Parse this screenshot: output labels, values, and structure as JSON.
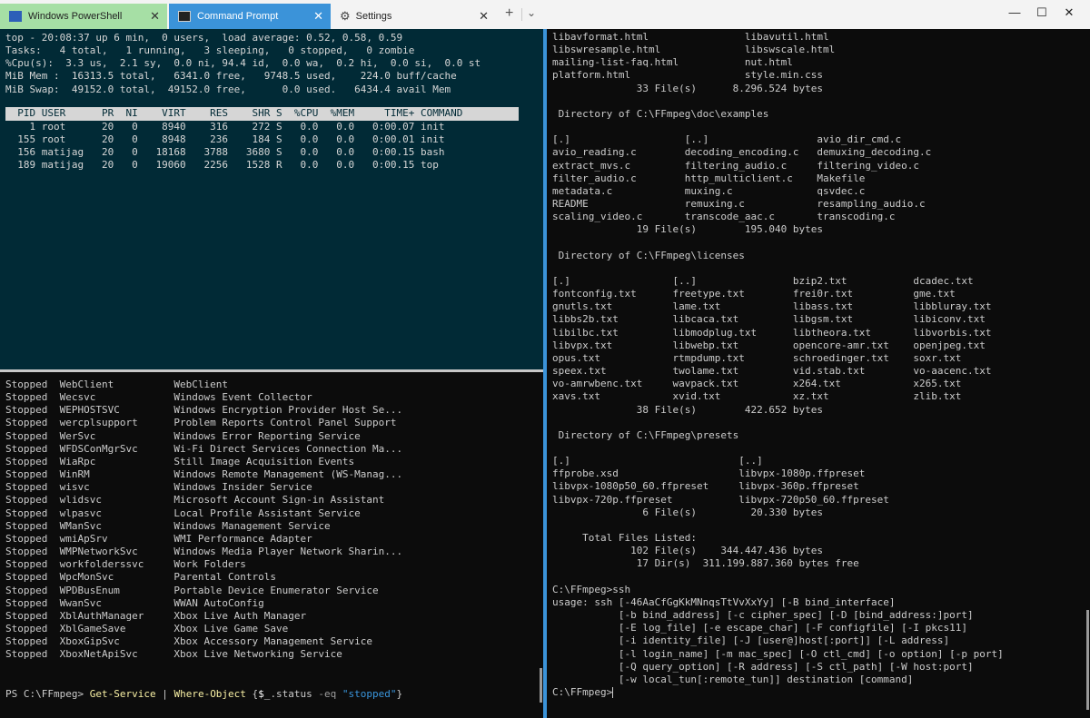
{
  "tabs": [
    {
      "label": "Windows PowerShell",
      "icon": "powershell-icon"
    },
    {
      "label": "Command Prompt",
      "icon": "cmd-icon"
    },
    {
      "label": "Settings",
      "icon": "gear-icon"
    }
  ],
  "window_controls": {
    "minimize": "—",
    "maximize": "☐",
    "close": "✕"
  },
  "colors": {
    "accent": "#3b93d9",
    "powershell_tab": "#a6dfa5",
    "top_pane_bg": "#012a36"
  },
  "top_pane": {
    "summary": "top - 20:08:37 up 6 min,  0 users,  load average: 0.52, 0.58, 0.59\nTasks:   4 total,   1 running,   3 sleeping,   0 stopped,   0 zombie\n%Cpu(s):  3.3 us,  2.1 sy,  0.0 ni, 94.4 id,  0.0 wa,  0.2 hi,  0.0 si,  0.0 st\nMiB Mem :  16313.5 total,   6341.0 free,   9748.5 used,    224.0 buff/cache\nMiB Swap:  49152.0 total,  49152.0 free,      0.0 used.   6434.4 avail Mem",
    "header": "  PID USER      PR  NI    VIRT    RES    SHR S  %CPU  %MEM     TIME+ COMMAND",
    "processes": "    1 root      20   0    8940    316    272 S   0.0   0.0   0:00.07 init\n  155 root      20   0    8948    236    184 S   0.0   0.0   0:00.01 init\n  156 matijag   20   0   18168   3788   3680 S   0.0   0.0   0:00.15 bash\n  189 matijag   20   0   19060   2256   1528 R   0.0   0.0   0:00.15 top"
  },
  "bottom_pane": {
    "services": "Stopped  WebClient          WebClient\nStopped  Wecsvc             Windows Event Collector\nStopped  WEPHOSTSVC         Windows Encryption Provider Host Se...\nStopped  wercplsupport      Problem Reports Control Panel Support\nStopped  WerSvc             Windows Error Reporting Service\nStopped  WFDSConMgrSvc      Wi-Fi Direct Services Connection Ma...\nStopped  WiaRpc             Still Image Acquisition Events\nStopped  WinRM              Windows Remote Management (WS-Manag...\nStopped  wisvc              Windows Insider Service\nStopped  wlidsvc            Microsoft Account Sign-in Assistant\nStopped  wlpasvc            Local Profile Assistant Service\nStopped  WManSvc            Windows Management Service\nStopped  wmiApSrv           WMI Performance Adapter\nStopped  WMPNetworkSvc      Windows Media Player Network Sharin...\nStopped  workfolderssvc     Work Folders\nStopped  WpcMonSvc          Parental Controls\nStopped  WPDBusEnum         Portable Device Enumerator Service\nStopped  WwanSvc            WWAN AutoConfig\nStopped  XblAuthManager     Xbox Live Auth Manager\nStopped  XblGameSave        Xbox Live Game Save\nStopped  XboxGipSvc         Xbox Accessory Management Service\nStopped  XboxNetApiSvc      Xbox Live Networking Service",
    "prompt": "PS C:\\FFmpeg> ",
    "cmd1": "Get-Service",
    "pipe": " | ",
    "cmd2": "Where-Object",
    "brace_open": " {",
    "var": "$_",
    "prop": ".status ",
    "op": "-eq",
    "space": " ",
    "str": "\"stopped\"",
    "brace_close": "}"
  },
  "right_pane": {
    "output": "libavformat.html                libavutil.html\nlibswresample.html              libswscale.html\nmailing-list-faq.html           nut.html\nplatform.html                   style.min.css\n              33 File(s)      8.296.524 bytes\n\n Directory of C:\\FFmpeg\\doc\\examples\n\n[.]                   [..]                  avio_dir_cmd.c\navio_reading.c        decoding_encoding.c   demuxing_decoding.c\nextract_mvs.c         filtering_audio.c     filtering_video.c\nfilter_audio.c        http_multiclient.c    Makefile\nmetadata.c            muxing.c              qsvdec.c\nREADME                remuxing.c            resampling_audio.c\nscaling_video.c       transcode_aac.c       transcoding.c\n              19 File(s)        195.040 bytes\n\n Directory of C:\\FFmpeg\\licenses\n\n[.]                 [..]                bzip2.txt           dcadec.txt\nfontconfig.txt      freetype.txt        frei0r.txt          gme.txt\ngnutls.txt          lame.txt            libass.txt          libbluray.txt\nlibbs2b.txt         libcaca.txt         libgsm.txt          libiconv.txt\nlibilbc.txt         libmodplug.txt      libtheora.txt       libvorbis.txt\nlibvpx.txt          libwebp.txt         opencore-amr.txt    openjpeg.txt\nopus.txt            rtmpdump.txt        schroedinger.txt    soxr.txt\nspeex.txt           twolame.txt         vid.stab.txt        vo-aacenc.txt\nvo-amrwbenc.txt     wavpack.txt         x264.txt            x265.txt\nxavs.txt            xvid.txt            xz.txt              zlib.txt\n              38 File(s)        422.652 bytes\n\n Directory of C:\\FFmpeg\\presets\n\n[.]                            [..]\nffprobe.xsd                    libvpx-1080p.ffpreset\nlibvpx-1080p50_60.ffpreset     libvpx-360p.ffpreset\nlibvpx-720p.ffpreset           libvpx-720p50_60.ffpreset\n               6 File(s)         20.330 bytes\n\n     Total Files Listed:\n             102 File(s)    344.447.436 bytes\n              17 Dir(s)  311.199.887.360 bytes free\n\nC:\\FFmpeg>ssh\nusage: ssh [-46AaCfGgKkMNnqsTtVvXxYy] [-B bind_interface]\n           [-b bind_address] [-c cipher_spec] [-D [bind_address:]port]\n           [-E log_file] [-e escape_char] [-F configfile] [-I pkcs11]\n           [-i identity_file] [-J [user@]host[:port]] [-L address]\n           [-l login_name] [-m mac_spec] [-O ctl_cmd] [-o option] [-p port]\n           [-Q query_option] [-R address] [-S ctl_path] [-W host:port]\n           [-w local_tun[:remote_tun]] destination [command]\n",
    "prompt": "C:\\FFmpeg>"
  }
}
